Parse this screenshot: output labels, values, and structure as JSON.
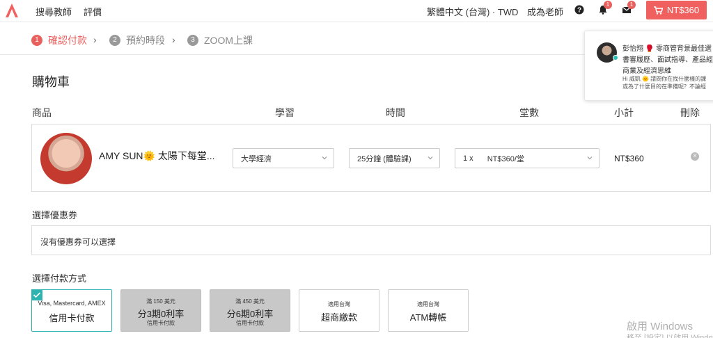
{
  "nav": {
    "search_teacher": "搜尋教師",
    "reviews": "評價",
    "language_currency": "繁體中文 (台灣) · TWD",
    "become_teacher": "成為老師",
    "notifications_count": "1",
    "messages_count": "1",
    "cart_total": "NT$360"
  },
  "steps": [
    {
      "num": "1",
      "label": "確認付款"
    },
    {
      "num": "2",
      "label": "預約時段"
    },
    {
      "num": "3",
      "label": "ZOOM上課"
    }
  ],
  "page_title": "購物車",
  "columns": {
    "product": "商品",
    "subject": "學習",
    "time": "時間",
    "sessions": "堂數",
    "subtotal": "小計",
    "delete": "刪除"
  },
  "cart_item": {
    "teacher": "AMY SUN🌞 太陽下每堂...",
    "subject": "大學經濟",
    "duration": "25分鐘 (體驗課)",
    "qty": "1 x",
    "price_per": "NT$360/堂",
    "subtotal": "NT$360"
  },
  "coupon": {
    "title": "選擇優惠券",
    "empty": "沒有優惠券可以選擇"
  },
  "payment": {
    "title": "選擇付款方式",
    "options": [
      {
        "l1": "Visa, Mastercard, AMEX",
        "l2": "信用卡付款",
        "l3": ""
      },
      {
        "l1": "滿 150 美元",
        "l2": "分3期0利率",
        "l3": "信用卡付款"
      },
      {
        "l1": "滿 450 美元",
        "l2": "分6期0利率",
        "l3": "信用卡付款"
      },
      {
        "l1": "適用台灣",
        "l2": "超商繳款",
        "l3": ""
      },
      {
        "l1": "適用台灣",
        "l2": "ATM轉帳",
        "l3": ""
      }
    ]
  },
  "popup": {
    "line1": "彭怡翔 🥊 零商管背景最佳選",
    "line2": "書審履歷、面試指導、產品經",
    "line3": "商業及經濟思維",
    "line4": "Hi 威凱 🌞 請問你在找什麼樣的課",
    "line5": "或為了什麼目的在準備呢？不論經"
  },
  "watermark": {
    "line1": "啟用 Windows",
    "line2": "移至 [設定] 以啟用 Windows"
  },
  "colors": {
    "accent": "#f0605f",
    "teal": "#2fb3b0"
  }
}
